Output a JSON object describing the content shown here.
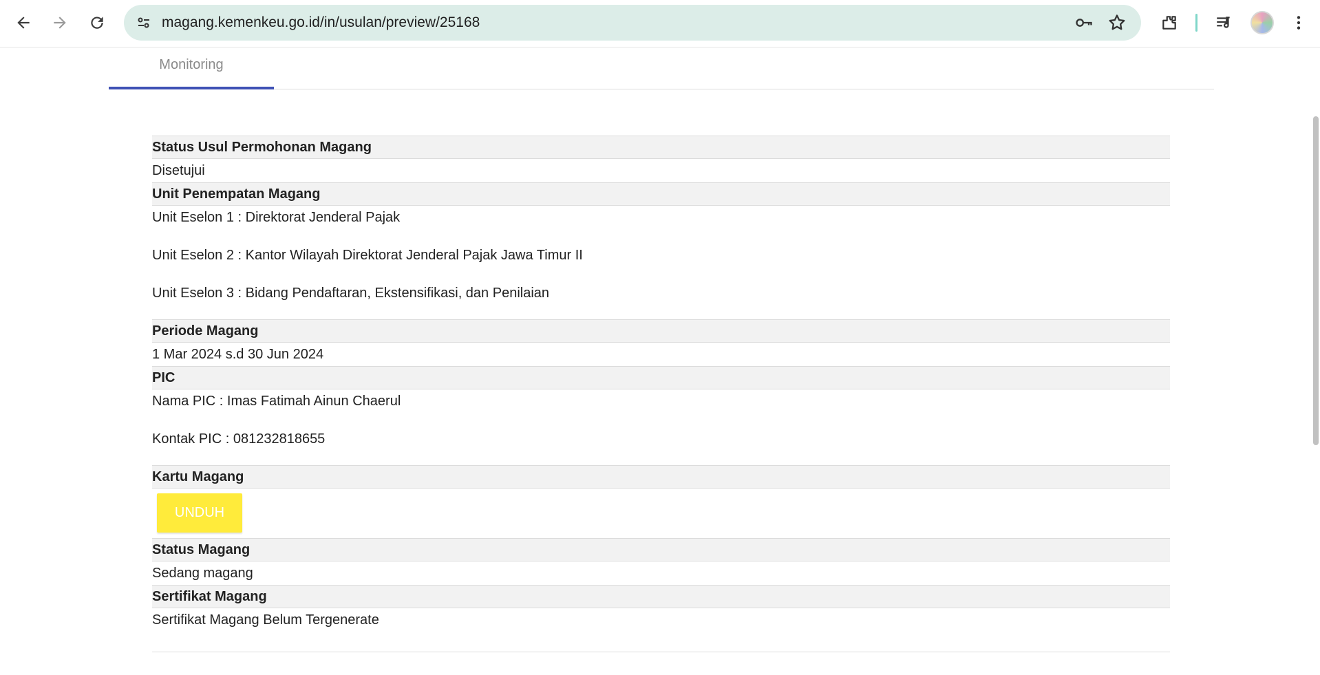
{
  "browser": {
    "url": "magang.kemenkeu.go.id/in/usulan/preview/25168",
    "icons": [
      "back-icon",
      "forward-icon",
      "reload-icon",
      "site-settings-icon",
      "password-key-icon",
      "bookmark-star-icon",
      "extensions-icon",
      "media-queue-icon",
      "profile-avatar",
      "more-menu-icon"
    ]
  },
  "tabs": {
    "monitoring_label": "Monitoring"
  },
  "sections": {
    "status_usul": {
      "heading": "Status Usul Permohonan Magang",
      "value": "Disetujui"
    },
    "unit_penempatan": {
      "heading": "Unit Penempatan Magang",
      "eselon1": "Unit Eselon 1 : Direktorat Jenderal Pajak",
      "eselon2": "Unit Eselon 2 : Kantor Wilayah Direktorat Jenderal Pajak Jawa Timur II",
      "eselon3": "Unit Eselon 3 : Bidang Pendaftaran, Ekstensifikasi, dan Penilaian"
    },
    "periode": {
      "heading": "Periode Magang",
      "value": "1 Mar 2024 s.d 30 Jun 2024"
    },
    "pic": {
      "heading": "PIC",
      "nama": "Nama PIC : Imas Fatimah Ainun Chaerul",
      "kontak": "Kontak PIC : 081232818655"
    },
    "kartu": {
      "heading": "Kartu Magang",
      "button_label": "UNDUH",
      "button_color": "#ffeb3b"
    },
    "status_magang": {
      "heading": "Status Magang",
      "value": "Sedang magang"
    },
    "sertifikat": {
      "heading": "Sertifikat Magang",
      "value": "Sertifikat Magang Belum Tergenerate"
    }
  },
  "colors": {
    "tab_accent": "#3f51b5",
    "omnibox_bg": "#dcede8",
    "header_row_bg": "#f2f2f2"
  }
}
